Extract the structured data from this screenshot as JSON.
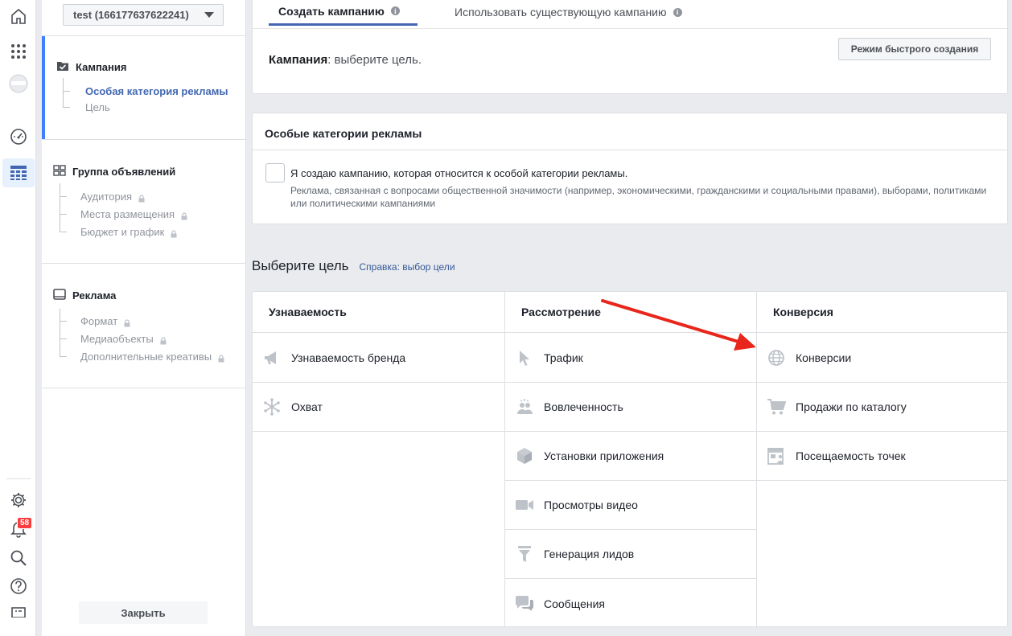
{
  "rail": {
    "notifications_count": "58"
  },
  "nav": {
    "account": "test (166177637622241)",
    "campaign": {
      "title": "Кампания",
      "items": [
        "Особая категория рекламы",
        "Цель"
      ]
    },
    "adset": {
      "title": "Группа объявлений",
      "items": [
        "Аудитория",
        "Места размещения",
        "Бюджет и график"
      ]
    },
    "ad": {
      "title": "Реклама",
      "items": [
        "Формат",
        "Медиаобъекты",
        "Дополнительные креативы"
      ]
    },
    "close_label": "Закрыть"
  },
  "tabs": {
    "create": "Создать кампанию",
    "existing": "Использовать существующую кампанию"
  },
  "campaign_header": {
    "label": "Кампания",
    "hint": ": выберите цель.",
    "quick_create": "Режим быстрого создания"
  },
  "special": {
    "title": "Особые категории рекламы",
    "checkbox_label": "Я создаю кампанию, которая относится к особой категории рекламы.",
    "description": "Реклама, связанная с вопросами общественной значимости (например, экономическими, гражданскими и социальными правами), выборами, политиками или политическими кампаниями"
  },
  "objective": {
    "title": "Выберите цель",
    "help_link": "Справка: выбор цели",
    "columns": [
      {
        "title": "Узнаваемость",
        "items": [
          "Узнаваемость бренда",
          "Охват"
        ]
      },
      {
        "title": "Рассмотрение",
        "items": [
          "Трафик",
          "Вовлеченность",
          "Установки приложения",
          "Просмотры видео",
          "Генерация лидов",
          "Сообщения"
        ]
      },
      {
        "title": "Конверсия",
        "items": [
          "Конверсии",
          "Продажи по каталогу",
          "Посещаемость точек"
        ]
      }
    ]
  },
  "colors": {
    "accent": "#4267b2",
    "arrow": "#e8261b",
    "icon_gray": "#bec3c9"
  }
}
